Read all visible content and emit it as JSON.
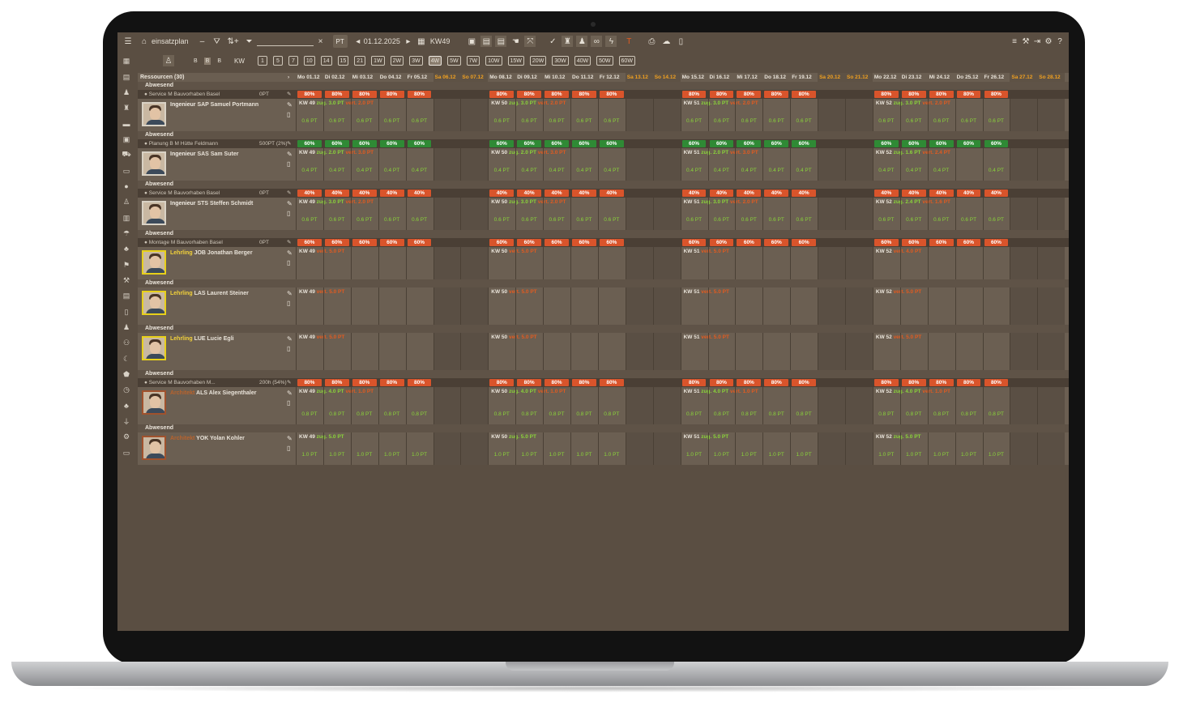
{
  "toolbar": {
    "app_title": "einsatzplan",
    "date": "01.12.2025",
    "week": "KW49",
    "pt_label": "PT",
    "search_placeholder": "",
    "ranges_label": "KW",
    "ranges": [
      "1",
      "5",
      "7",
      "10",
      "14",
      "15",
      "21",
      "1W",
      "2W",
      "3W",
      "4W",
      "5W",
      "7W",
      "10W",
      "15W",
      "20W",
      "30W",
      "40W",
      "50W",
      "60W"
    ],
    "selected_range": "4W",
    "view_buttons": [
      "B",
      "B",
      "B"
    ],
    "flag_label": "T"
  },
  "grid": {
    "resources_label": "Ressourcen (30)",
    "days": [
      "Mo 01.12",
      "Di 02.12",
      "Mi 03.12",
      "Do 04.12",
      "Fr 05.12",
      "Sa 06.12",
      "So 07.12",
      "Mo 08.12",
      "Di 09.12",
      "Mi 10.12",
      "Do 11.12",
      "Fr 12.12",
      "Sa 13.12",
      "So 14.12",
      "Mo 15.12",
      "Di 16.12",
      "Mi 17.12",
      "Do 18.12",
      "Fr 19.12",
      "Sa 20.12",
      "So 21.12",
      "Mo 22.12",
      "Di 23.12",
      "Mi 24.12",
      "Do 25.12",
      "Fr 26.12",
      "Sa 27.12",
      "So 28.12"
    ],
    "weeks": [
      "KW 49",
      "KW 50",
      "KW 51",
      "KW 52"
    ],
    "absent_label": "Abwesend"
  },
  "people": [
    {
      "role": "Ingenieur",
      "code": "SAP",
      "name": "Samuel Portmann",
      "assignment": "Service M Bauvorhaben Basel",
      "assign_qty": "0PT",
      "pct": "80%",
      "pct_color": "red",
      "zug": [
        "3.0 PT",
        "3.0 PT",
        "3.0 PT",
        "3.0 PT"
      ],
      "vert": [
        "2.0 PT",
        "2.0 PT",
        "2.0 PT",
        "2.0 PT"
      ],
      "pt": "0.6 PT"
    },
    {
      "role": "Ingenieur",
      "code": "SAS",
      "name": "Sam Suter",
      "assignment": "Planung B M Hütte Feldmann",
      "assign_qty": "500PT (2%)",
      "pct": "60%",
      "pct_color": "grn",
      "zug": [
        "2.0 PT",
        "2.0 PT",
        "2.0 PT",
        "1.6 PT"
      ],
      "vert": [
        "3.0 PT",
        "3.0 PT",
        "3.0 PT",
        "2.4 PT"
      ],
      "pt": "0.4 PT"
    },
    {
      "role": "Ingenieur",
      "code": "STS",
      "name": "Steffen Schmidt",
      "assignment": "Service M Bauvorhaben Basel",
      "assign_qty": "0PT",
      "pct": "40%",
      "pct_color": "red",
      "zug": [
        "3.0 PT",
        "3.0 PT",
        "3.0 PT",
        "2.4 PT"
      ],
      "vert": [
        "2.0 PT",
        "2.0 PT",
        "2.0 PT",
        "1.6 PT"
      ],
      "pt": "0.6 PT"
    },
    {
      "role": "Lehrling",
      "code": "JOB",
      "name": "Jonathan Berger",
      "assignment": "Montage M Bauvorhaben Basel",
      "assign_qty": "0PT",
      "pct": "60%",
      "pct_color": "red",
      "zug": [],
      "vert": [
        "5.0 PT",
        "5.0 PT",
        "5.0 PT",
        "4.0 PT"
      ],
      "pt": ""
    },
    {
      "role": "Lehrling",
      "code": "LAS",
      "name": "Laurent Steiner",
      "assignment": "",
      "assign_qty": "",
      "pct": "",
      "pct_color": "",
      "zug": [],
      "vert": [
        "5.0 PT",
        "5.0 PT",
        "5.0 PT",
        "5.0 PT"
      ],
      "pt": ""
    },
    {
      "role": "Lehrling",
      "code": "LUE",
      "name": "Lucie Egli",
      "assignment": "",
      "assign_qty": "",
      "pct": "",
      "pct_color": "",
      "zug": [],
      "vert": [
        "5.0 PT",
        "5.0 PT",
        "5.0 PT",
        "5.0 PT"
      ],
      "pt": ""
    },
    {
      "role": "Architekt",
      "code": "ALS",
      "name": "Alex Siegenthaler",
      "assignment": "Service M Bauvorhaben M...",
      "assign_qty": "200h (54%)",
      "pct": "80%",
      "pct_color": "red",
      "zug": [
        "4.0 PT",
        "4.0 PT",
        "4.0 PT",
        "4.0 PT"
      ],
      "vert": [
        "1.0 PT",
        "1.0 PT",
        "1.0 PT",
        "1.0 PT"
      ],
      "pt": "0.8 PT"
    },
    {
      "role": "Architekt",
      "code": "YOK",
      "name": "Yolan Kohler",
      "assignment": "",
      "assign_qty": "",
      "pct": "",
      "pct_color": "",
      "zug": [
        "5.0 PT",
        "5.0 PT",
        "5.0 PT",
        "5.0 PT"
      ],
      "vert": [],
      "pt": "1.0 PT"
    }
  ]
}
